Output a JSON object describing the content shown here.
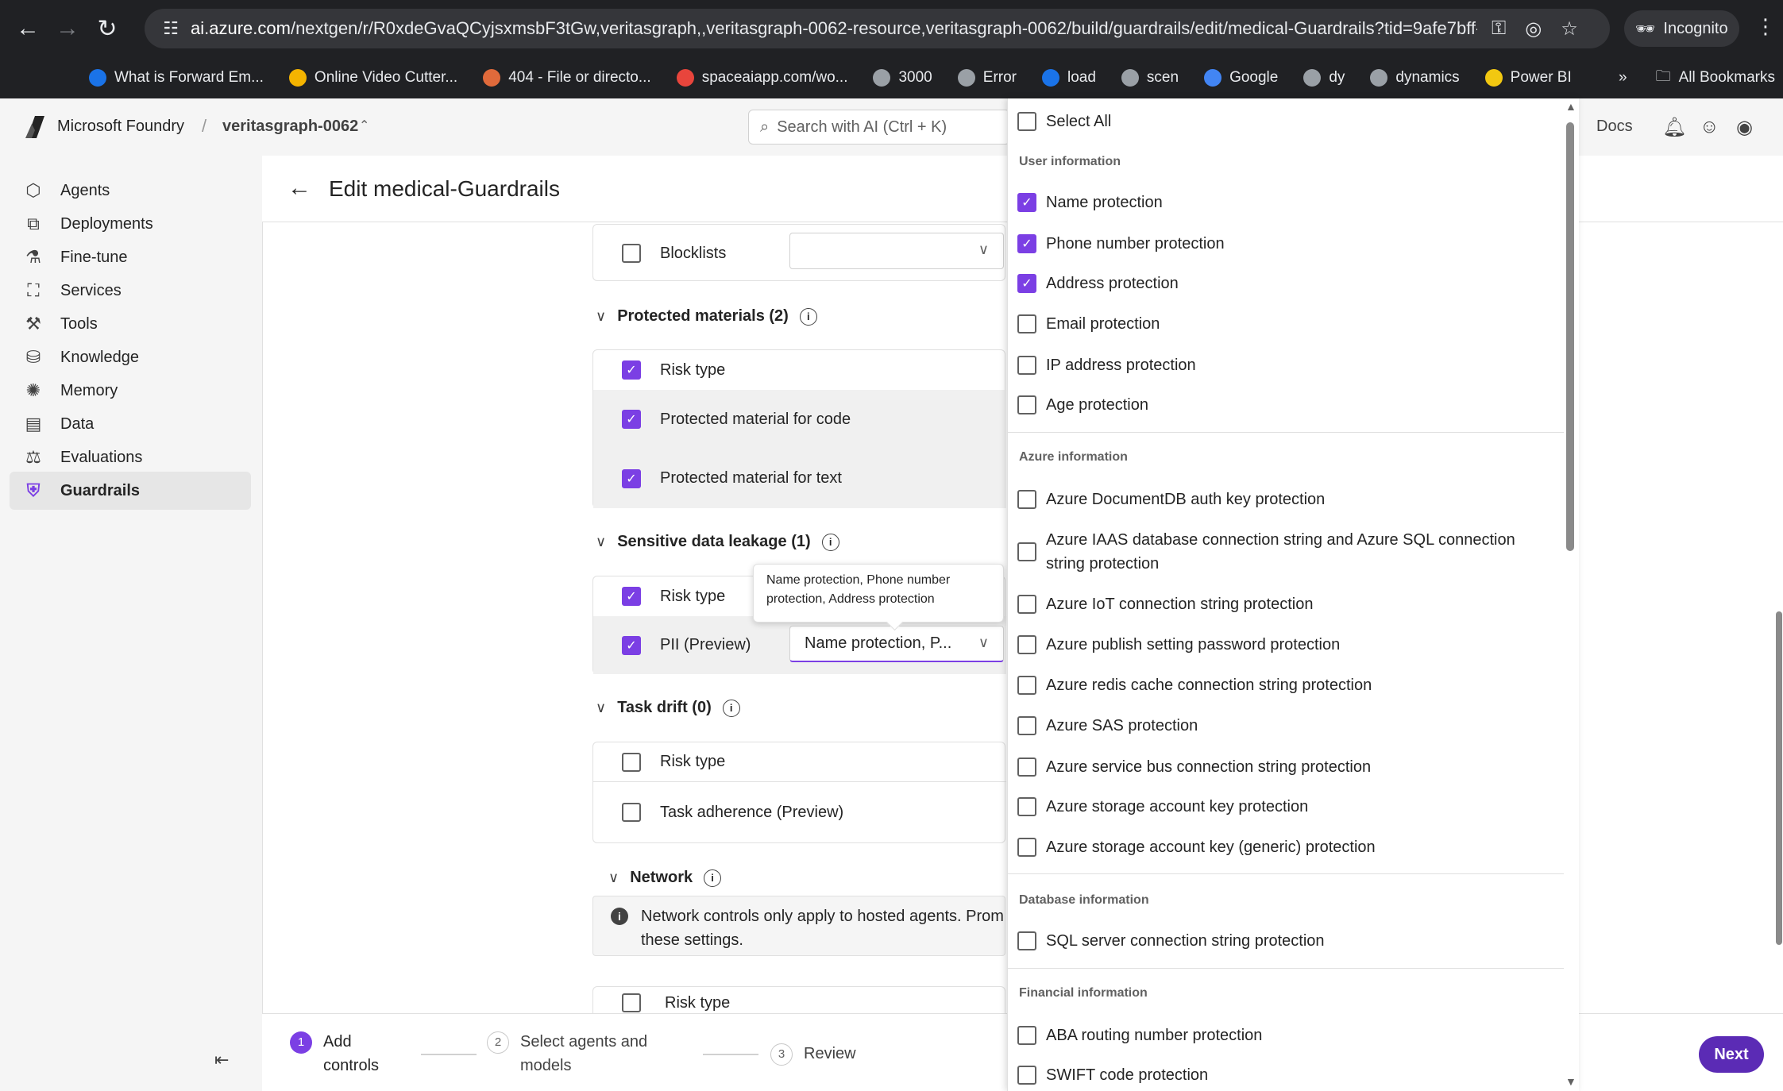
{
  "browser": {
    "url_host": "ai.azure.com",
    "url_path": "/nextgen/r/R0xdeGvaQCyjsxmsbF3tGw,veritasgraph,,veritasgraph-0062-resource,veritasgraph-0062/build/guardrails/edit/medical-Guardrails?tid=9afe7bff-59bc-4...",
    "incognito_label": "Incognito",
    "bookmarks": [
      {
        "label": "What is Forward Em...",
        "color": "#1a73e8"
      },
      {
        "label": "Online Video Cutter...",
        "color": "#f4b400"
      },
      {
        "label": "404 - File or directo...",
        "color": "#e06a3b"
      },
      {
        "label": "spaceaiapp.com/wo...",
        "color": "#e8453c"
      },
      {
        "label": "3000",
        "color": "#9aa0a6"
      },
      {
        "label": "Error",
        "color": "#9aa0a6"
      },
      {
        "label": "load",
        "color": "#1a73e8"
      },
      {
        "label": "scen",
        "color": "#9aa0a6"
      },
      {
        "label": "Google",
        "color": "#4285f4"
      },
      {
        "label": "dy",
        "color": "#9aa0a6"
      },
      {
        "label": "dynamics",
        "color": "#9aa0a6"
      },
      {
        "label": "Power BI",
        "color": "#f2c811"
      }
    ],
    "all_bookmarks_label": "All Bookmarks"
  },
  "header": {
    "brand": "Microsoft Foundry",
    "project": "veritasgraph-0062",
    "search_placeholder": "Search with AI (Ctrl + K)",
    "docs": "Docs"
  },
  "sidebar": {
    "items": [
      {
        "label": "Agents",
        "icon": "agents-icon"
      },
      {
        "label": "Deployments",
        "icon": "deployments-icon"
      },
      {
        "label": "Fine-tune",
        "icon": "flask-icon"
      },
      {
        "label": "Services",
        "icon": "services-icon"
      },
      {
        "label": "Tools",
        "icon": "tools-icon"
      },
      {
        "label": "Knowledge",
        "icon": "knowledge-icon"
      },
      {
        "label": "Memory",
        "icon": "brain-icon"
      },
      {
        "label": "Data",
        "icon": "data-icon"
      },
      {
        "label": "Evaluations",
        "icon": "scales-icon"
      },
      {
        "label": "Guardrails",
        "icon": "shield-icon"
      }
    ],
    "active": "Guardrails"
  },
  "page": {
    "title": "Edit medical-Guardrails",
    "blocklists_label": "Blocklists",
    "protected_materials": {
      "heading": "Protected materials (2)",
      "risk_type": "Risk type",
      "rows": [
        "Protected material for code",
        "Protected material for text"
      ]
    },
    "sensitive": {
      "heading": "Sensitive data leakage (1)",
      "risk_type": "Risk type",
      "pii_label": "PII (Preview)",
      "pii_value": "Name protection, P...",
      "tooltip": "Name protection, Phone number protection, Address protection"
    },
    "task_drift": {
      "heading": "Task drift (0)",
      "risk_type": "Risk type",
      "row": "Task adherence (Preview)"
    },
    "network": {
      "heading": "Network",
      "notice": "Network controls only apply to hosted agents. Prompt... these settings.",
      "notice_line1": "Network controls only apply to hosted agents. Prom",
      "notice_line2": "these settings.",
      "risk_type": "Risk type"
    }
  },
  "footer": {
    "steps": [
      {
        "num": "1",
        "label_line1": "Add",
        "label_line2": "controls"
      },
      {
        "num": "2",
        "label_line1": "Select agents and",
        "label_line2": "models"
      },
      {
        "num": "3",
        "label_line1": "Review",
        "label_line2": ""
      }
    ],
    "next": "Next"
  },
  "flyout": {
    "select_all": "Select All",
    "groups": [
      {
        "heading": "User information",
        "items": [
          {
            "label": "Name protection",
            "checked": true
          },
          {
            "label": "Phone number protection",
            "checked": true
          },
          {
            "label": "Address protection",
            "checked": true
          },
          {
            "label": "Email protection",
            "checked": false
          },
          {
            "label": "IP address protection",
            "checked": false
          },
          {
            "label": "Age protection",
            "checked": false
          }
        ]
      },
      {
        "heading": "Azure information",
        "items": [
          {
            "label": "Azure DocumentDB auth key protection",
            "checked": false
          },
          {
            "label": "Azure IAAS database connection string and Azure SQL connection string protection",
            "checked": false
          },
          {
            "label": "Azure IoT connection string protection",
            "checked": false
          },
          {
            "label": "Azure publish setting password protection",
            "checked": false
          },
          {
            "label": "Azure redis cache connection string protection",
            "checked": false
          },
          {
            "label": "Azure SAS protection",
            "checked": false
          },
          {
            "label": "Azure service bus connection string protection",
            "checked": false
          },
          {
            "label": "Azure storage account key protection",
            "checked": false
          },
          {
            "label": "Azure storage account key (generic) protection",
            "checked": false
          }
        ]
      },
      {
        "heading": "Database information",
        "items": [
          {
            "label": "SQL server connection string protection",
            "checked": false
          }
        ]
      },
      {
        "heading": "Financial information",
        "items": [
          {
            "label": "ABA routing number protection",
            "checked": false
          },
          {
            "label": "SWIFT code protection",
            "checked": false
          }
        ]
      }
    ],
    "azure_iaas_line1": "Azure IAAS database connection string and Azure SQL connection",
    "azure_iaas_line2": "string protection"
  },
  "colors": {
    "accent": "#7b3fe4",
    "next_button": "#5b2bb5",
    "chrome_dark": "#202124"
  }
}
